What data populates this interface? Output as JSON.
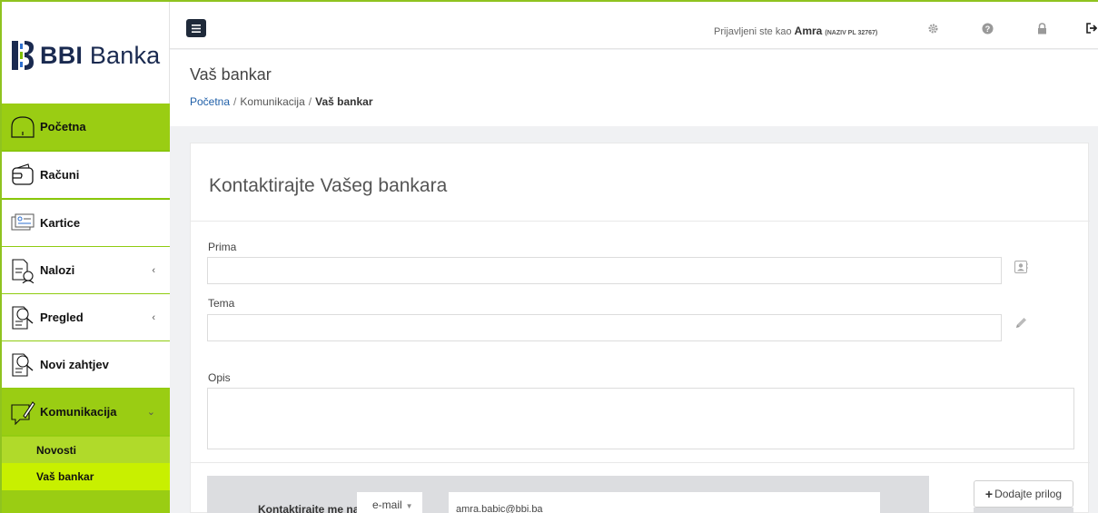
{
  "brand": {
    "name_bold": "BBI",
    "name_regular": "Banka"
  },
  "sidebar": {
    "items": [
      {
        "label": "Početna",
        "icon": "home-icon"
      },
      {
        "label": "Računi",
        "icon": "wallet-icon"
      },
      {
        "label": "Kartice",
        "icon": "cards-icon"
      },
      {
        "label": "Nalozi",
        "icon": "orders-icon",
        "chevron": "‹"
      },
      {
        "label": "Pregled",
        "icon": "overview-icon",
        "chevron": "‹"
      },
      {
        "label": "Novi zahtjev",
        "icon": "new-request-icon"
      },
      {
        "label": "Komunikacija",
        "icon": "communication-icon",
        "chevron": "⌄"
      }
    ],
    "subitems": [
      {
        "label": "Novosti"
      },
      {
        "label": "Vaš bankar"
      }
    ]
  },
  "header": {
    "user_prefix": "Prijavljeni ste kao",
    "user_name": "Amra",
    "user_org": "(NAZIV PL 32767)"
  },
  "page": {
    "title": "Vaš bankar",
    "breadcrumb": [
      "Početna",
      "Komunikacija",
      "Vaš bankar"
    ],
    "separator": "/"
  },
  "form": {
    "title": "Kontaktirajte Vašeg bankara",
    "to_label": "Prima",
    "to_value": "",
    "subject_label": "Tema",
    "subject_value": "",
    "desc_label": "Opis",
    "desc_value": "",
    "contact_label": "Kontaktirajte me na",
    "contact_method": "e-mail",
    "contact_email": "amra.babic@bbi.ba",
    "attach_label": "Dodajte prilog"
  },
  "colors": {
    "sidebar_green": "#9acd13",
    "active_sub": "#c8f000",
    "brand_navy": "#1a2a50"
  }
}
